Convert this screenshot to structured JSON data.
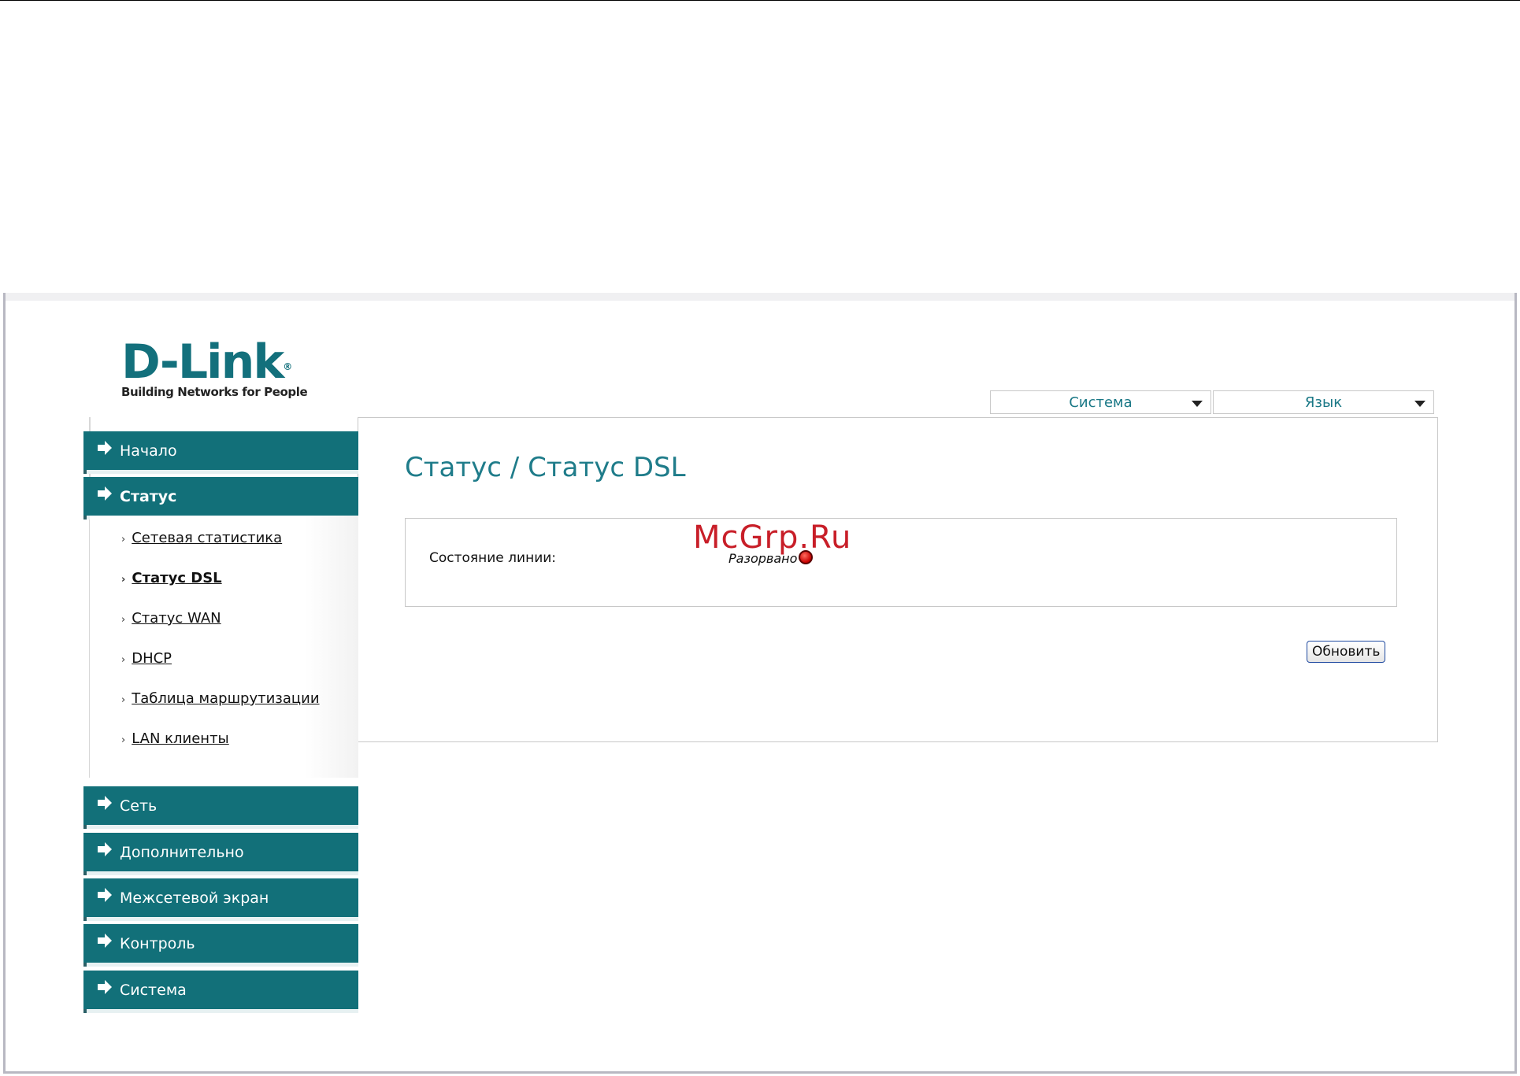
{
  "header": {
    "logo_text": "D-Link",
    "logo_tagline": "Building Networks for People"
  },
  "toolbar": {
    "system_label": "Система",
    "language_label": "Язык"
  },
  "main": {
    "title": "Статус / Статус DSL",
    "line_state_label": "Состояние линии:",
    "line_state_value": "Разорвано",
    "line_state_color": "#d40000",
    "refresh_label": "Обновить",
    "watermark": "McGrp.Ru"
  },
  "sidebar": {
    "accent_color": "#127079",
    "items": [
      {
        "label": "Начало",
        "icon": "arrow-right-icon"
      },
      {
        "label": "Статус",
        "icon": "arrow-right-icon",
        "expanded": true
      },
      {
        "label": "Сеть",
        "icon": "arrow-right-icon"
      },
      {
        "label": "Дополнительно",
        "icon": "arrow-right-icon"
      },
      {
        "label": "Межсетевой экран",
        "icon": "arrow-right-icon"
      },
      {
        "label": "Контроль",
        "icon": "arrow-right-icon"
      },
      {
        "label": "Система",
        "icon": "arrow-right-icon"
      }
    ],
    "submenu": [
      {
        "label": "Сетевая статистика"
      },
      {
        "label": "Статус DSL",
        "active": true
      },
      {
        "label": "Статус WAN"
      },
      {
        "label": "DHCP"
      },
      {
        "label": "Таблица маршрутизации"
      },
      {
        "label": "LAN клиенты"
      }
    ]
  }
}
